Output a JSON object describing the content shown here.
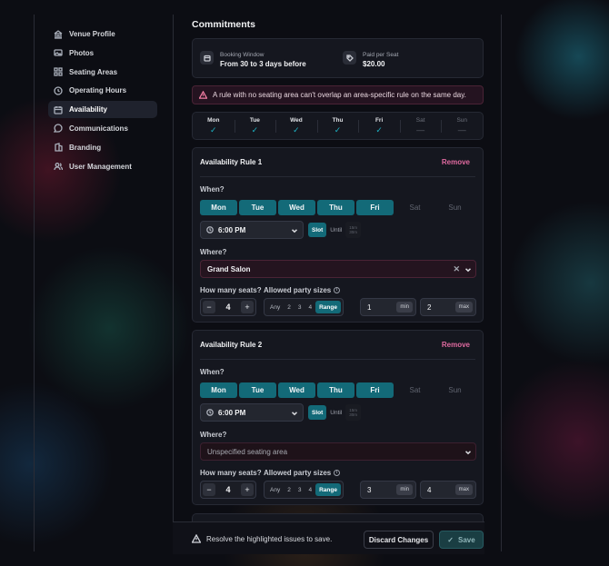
{
  "sidebar": {
    "items": [
      {
        "label": "Venue Profile",
        "icon": "building-icon"
      },
      {
        "label": "Photos",
        "icon": "image-icon"
      },
      {
        "label": "Seating Areas",
        "icon": "grid-icon"
      },
      {
        "label": "Operating Hours",
        "icon": "clock-icon"
      },
      {
        "label": "Availability",
        "icon": "calendar-icon",
        "active": true
      },
      {
        "label": "Communications",
        "icon": "chat-icon"
      },
      {
        "label": "Branding",
        "icon": "palette-icon"
      },
      {
        "label": "User Management",
        "icon": "users-icon"
      }
    ]
  },
  "main": {
    "title": "Commitments",
    "booking_window": {
      "label": "Booking Window",
      "value": "From 30 to 3 days before"
    },
    "paid_per_seat": {
      "label": "Paid per Seat",
      "value": "$20.00"
    },
    "warning": "A rule with no seating area can't overlap an area-specific rule on the same day.",
    "week_summary": [
      {
        "day": "Mon",
        "enabled": true
      },
      {
        "day": "Tue",
        "enabled": true
      },
      {
        "day": "Wed",
        "enabled": true
      },
      {
        "day": "Thu",
        "enabled": true
      },
      {
        "day": "Fri",
        "enabled": true
      },
      {
        "day": "Sat",
        "enabled": false
      },
      {
        "day": "Sun",
        "enabled": false
      }
    ]
  },
  "labels": {
    "when": "When?",
    "where": "Where?",
    "seats": "How many seats?",
    "party": "Allowed party sizes",
    "remove": "Remove",
    "slot": "Slot",
    "until": "Until",
    "small_a": "15m",
    "small_b": "30m",
    "party_options": [
      "Any",
      "2",
      "3",
      "4",
      "Range"
    ],
    "min": "min",
    "max": "max",
    "minus": "−",
    "plus": "+"
  },
  "rules": [
    {
      "title": "Availability Rule 1",
      "days": [
        "Mon",
        "Tue",
        "Wed",
        "Thu",
        "Fri",
        "Sat",
        "Sun"
      ],
      "days_on": [
        true,
        true,
        true,
        true,
        true,
        false,
        false
      ],
      "time": "6:00 PM",
      "mode": "Slot",
      "where": "Grand Salon",
      "where_filled": true,
      "seats": "4",
      "party_selected": "Range",
      "range_min": "1",
      "range_max": "2"
    },
    {
      "title": "Availability Rule 2",
      "days": [
        "Mon",
        "Tue",
        "Wed",
        "Thu",
        "Fri",
        "Sat",
        "Sun"
      ],
      "days_on": [
        true,
        true,
        true,
        true,
        true,
        false,
        false
      ],
      "time": "6:00 PM",
      "mode": "Slot",
      "where": "Unspecified seating area",
      "where_filled": false,
      "seats": "4",
      "party_selected": "Range",
      "range_min": "3",
      "range_max": "4"
    }
  ],
  "footer": {
    "message": "Resolve the highlighted issues to save.",
    "discard": "Discard Changes",
    "save": "Save"
  },
  "colors": {
    "accent": "#136a78",
    "danger": "#e06aa0",
    "background": "#0c0d13"
  }
}
